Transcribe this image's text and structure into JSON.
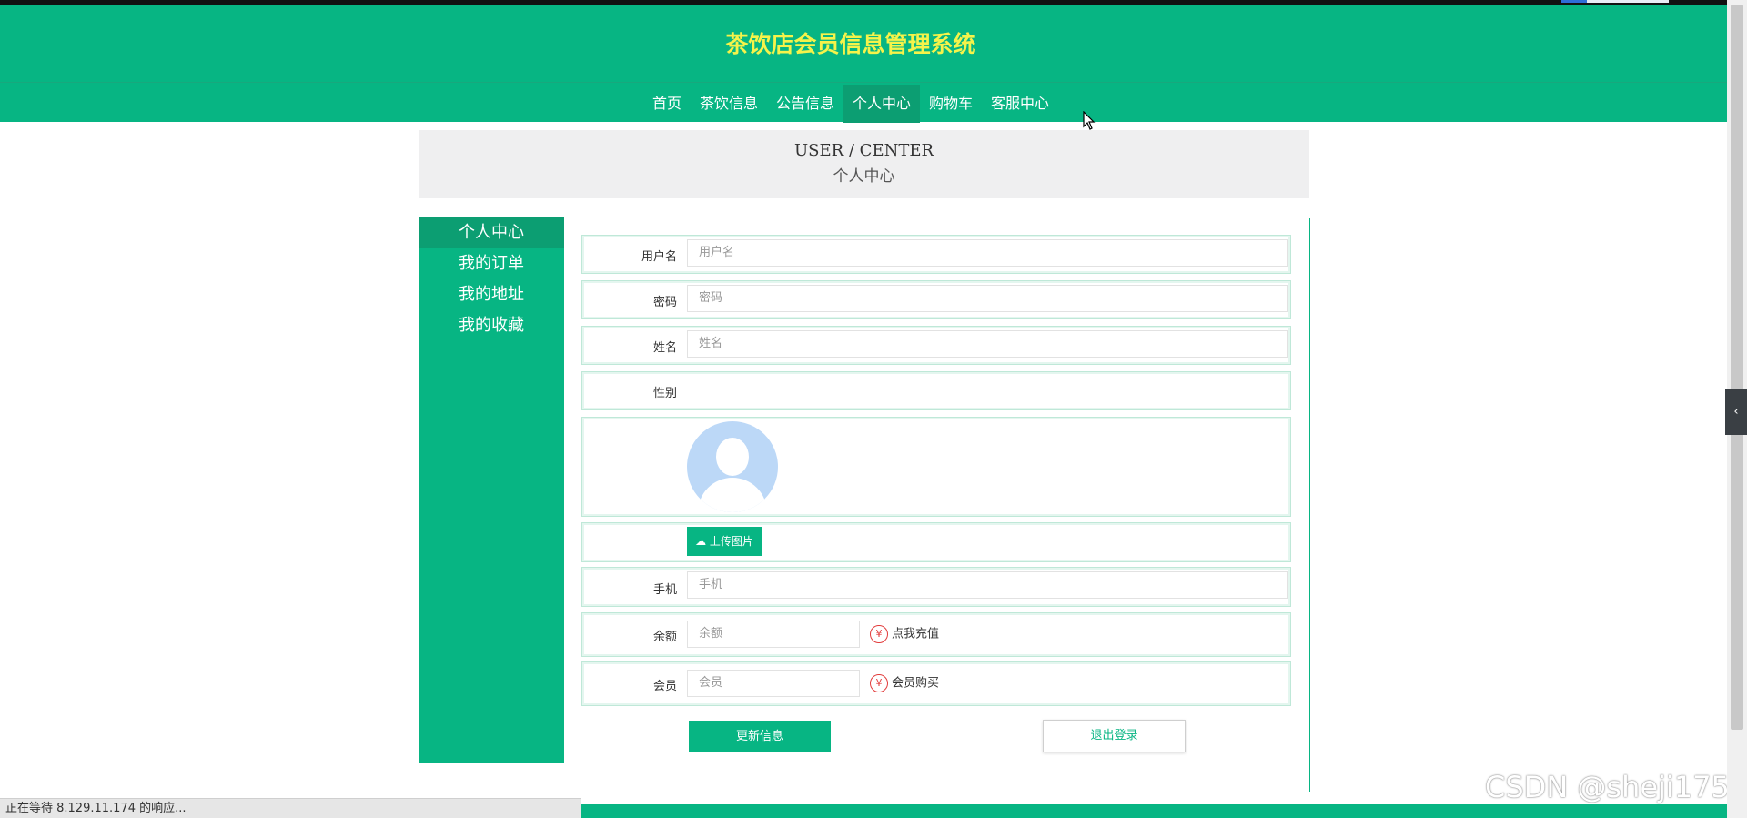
{
  "header": {
    "title": "茶饮店会员信息管理系统",
    "nav": [
      "首页",
      "茶饮信息",
      "公告信息",
      "个人中心",
      "购物车",
      "客服中心"
    ],
    "active_index": 3
  },
  "banner": {
    "en": "USER / CENTER",
    "cn": "个人中心"
  },
  "sidebar": {
    "items": [
      {
        "label": "个人中心"
      },
      {
        "label": "我的订单"
      },
      {
        "label": "我的地址"
      },
      {
        "label": "我的收藏"
      }
    ]
  },
  "form": {
    "username": {
      "label": "用户名",
      "placeholder": "用户名"
    },
    "password": {
      "label": "密码",
      "placeholder": "密码"
    },
    "name": {
      "label": "姓名",
      "placeholder": "姓名"
    },
    "gender": {
      "label": "性别"
    },
    "upload_label": "上传图片",
    "phone": {
      "label": "手机",
      "placeholder": "手机"
    },
    "balance": {
      "label": "余额",
      "placeholder": "余额",
      "action": "点我充值"
    },
    "member": {
      "label": "会员",
      "placeholder": "会员",
      "action": "会员购买"
    },
    "update_button": "更新信息",
    "logout_button": "退出登录"
  },
  "status_bar": "正在等待 8.129.11.174 的响应...",
  "watermark": "CSDN @sheji175",
  "colors": {
    "primary": "#07b583",
    "title": "#f5f34a",
    "active": "#0c9e72"
  }
}
